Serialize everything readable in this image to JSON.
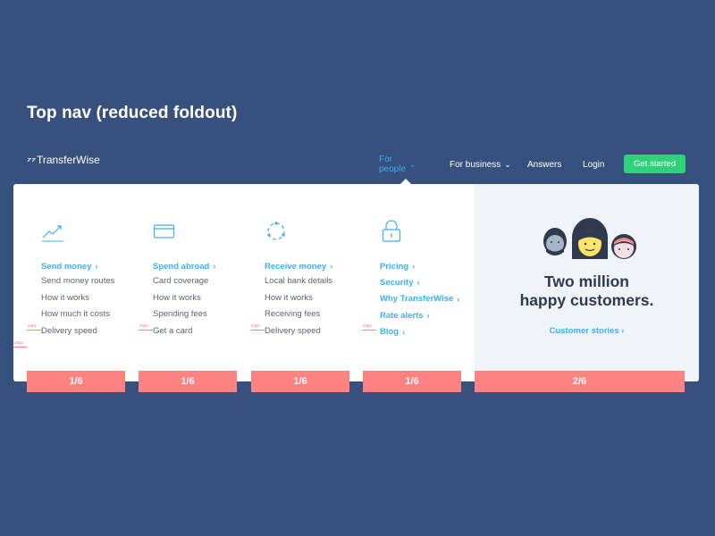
{
  "heading": "Top nav (reduced foldout)",
  "logo": {
    "mark": "⁷⁷",
    "text": "TransferWise"
  },
  "nav": {
    "items": [
      {
        "label": "For people",
        "chevron": "⌄"
      },
      {
        "label": "For business",
        "chevron": "⌄"
      },
      {
        "label": "Answers"
      },
      {
        "label": "Login"
      }
    ],
    "cta": "Get started"
  },
  "columns": [
    {
      "icon": "trending-up-icon",
      "head": "Send money",
      "items": [
        "Send money routes",
        "How it works",
        "How much it costs",
        "Delivery speed"
      ]
    },
    {
      "icon": "card-icon",
      "head": "Spend abroad",
      "items": [
        "Card coverage",
        "How it works",
        "Spending fees",
        "Get a card"
      ]
    },
    {
      "icon": "receive-icon",
      "head": "Receive money",
      "items": [
        "Local bank details",
        "How it works",
        "Receiving fees",
        "Delivery speed"
      ]
    },
    {
      "icon": "lock-icon",
      "head": "Pricing",
      "items": [
        "Security",
        "Why TransferWise",
        "Rate alerts",
        "Blog"
      ]
    }
  ],
  "chevron": "›",
  "promo": {
    "title_line1": "Two million",
    "title_line2": "happy customers.",
    "link": "Customer stories"
  },
  "spec_label": "24px",
  "grid": [
    "1/6",
    "1/6",
    "1/6",
    "1/6",
    "2/6"
  ],
  "colors": {
    "background": "#37517e",
    "accent": "#3cb0f0",
    "cta": "#2fd27a",
    "grid": "#fd8282"
  }
}
